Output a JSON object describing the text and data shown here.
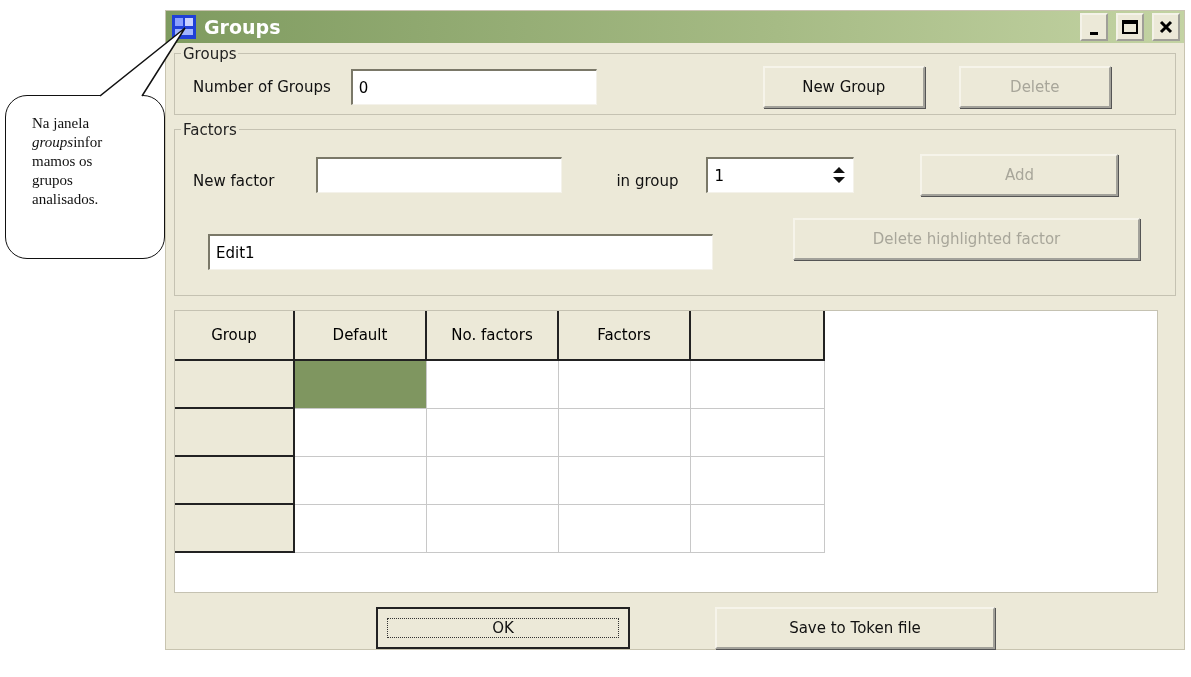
{
  "callout": {
    "parts": [
      {
        "text": "Na janela ",
        "italic": false
      },
      {
        "text": "groups",
        "italic": true
      },
      {
        "text": "infor mamos os grupos analisados.",
        "italic": false
      }
    ]
  },
  "window": {
    "title": "Groups"
  },
  "groups_box": {
    "legend": "Groups",
    "count_label": "Number of Groups",
    "count_value": "0",
    "buttons": [
      {
        "label": "New Group",
        "disabled": false
      },
      {
        "label": "Delete",
        "disabled": true
      }
    ]
  },
  "factors_box": {
    "legend": "Factors",
    "new_factor_label": "New factor",
    "in_group_label": "in group",
    "in_group_value": "1",
    "edit_value": "Edit1",
    "add_button": {
      "label": "Add",
      "disabled": true
    },
    "delete_button": {
      "label": "Delete highlighted factor",
      "disabled": true
    }
  },
  "table": {
    "columns": [
      "Group",
      "Default",
      "No. factors",
      "Factors",
      ""
    ],
    "rows": [
      {
        "cells": [
          {
            "selected": true
          },
          {
            "selected": false
          },
          {
            "selected": false
          },
          {
            "selected": false
          }
        ]
      },
      {
        "cells": [
          {
            "selected": false
          },
          {
            "selected": false
          },
          {
            "selected": false
          },
          {
            "selected": false
          }
        ]
      },
      {
        "cells": [
          {
            "selected": false
          },
          {
            "selected": false
          },
          {
            "selected": false
          },
          {
            "selected": false
          }
        ]
      },
      {
        "cells": [
          {
            "selected": false
          },
          {
            "selected": false
          },
          {
            "selected": false
          },
          {
            "selected": false
          }
        ]
      }
    ]
  },
  "footer_buttons": [
    {
      "label": "OK",
      "focused": true
    },
    {
      "label": "Save to Token file",
      "focused": false
    }
  ]
}
